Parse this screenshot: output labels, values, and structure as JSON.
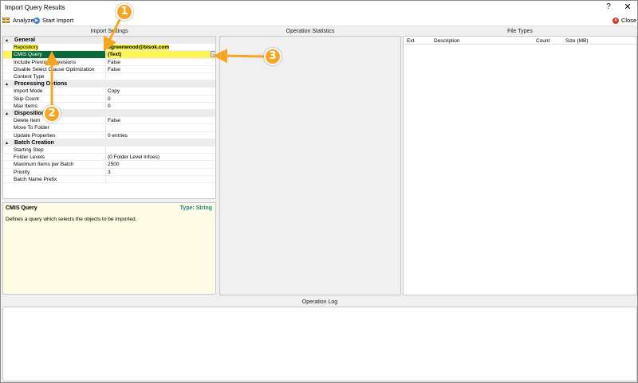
{
  "window": {
    "title": "Import Query Results",
    "help_glyph": "?",
    "close_glyph": "✕"
  },
  "toolbar": {
    "analyze_label": "Analyze",
    "start_import_label": "Start Import",
    "close_label": "Close"
  },
  "panels": {
    "import_settings": "Import Settings",
    "operation_statistics": "Operation Statistics",
    "file_types": "File Types",
    "operation_log": "Operation Log"
  },
  "settings": {
    "rows": [
      {
        "kind": "cat",
        "label": "General"
      },
      {
        "kind": "prop",
        "label": "Repository",
        "value": "dgreenwood@bisok.com"
      },
      {
        "kind": "prop",
        "label": "CMIS Query",
        "value": "(Text)"
      },
      {
        "kind": "prop",
        "label": "Include Previous Revisions",
        "value": "False"
      },
      {
        "kind": "prop",
        "label": "Disable Select Clause Optimization",
        "value": "False"
      },
      {
        "kind": "prop",
        "label": "Content Type",
        "value": ""
      },
      {
        "kind": "cat",
        "label": "Processing Options"
      },
      {
        "kind": "prop",
        "label": "Import Mode",
        "value": "Copy"
      },
      {
        "kind": "prop",
        "label": "Skip Count",
        "value": "0"
      },
      {
        "kind": "prop",
        "label": "Max Items",
        "value": "0"
      },
      {
        "kind": "cat",
        "label": "Disposition"
      },
      {
        "kind": "prop",
        "label": "Delete Item",
        "value": "False"
      },
      {
        "kind": "prop",
        "label": "Move To Folder",
        "value": ""
      },
      {
        "kind": "prop",
        "label": "Update Properties",
        "value": "0 entries"
      },
      {
        "kind": "cat",
        "label": "Batch Creation"
      },
      {
        "kind": "prop",
        "label": "Starting Step",
        "value": ""
      },
      {
        "kind": "prop",
        "label": "Folder Levels",
        "value": "(0 Folder Level Infoes)"
      },
      {
        "kind": "prop",
        "label": "Maximum Items per Batch",
        "value": "2500"
      },
      {
        "kind": "prop",
        "label": "Priority",
        "value": "3"
      },
      {
        "kind": "prop",
        "label": "Batch Name Prefix",
        "value": ""
      }
    ],
    "ellipsis": "..."
  },
  "description": {
    "title": "CMIS Query",
    "type": "Type: String",
    "text": "Defines a query which selects the objects to be imported."
  },
  "file_types": {
    "columns": [
      "Ext",
      "Description",
      "Count",
      "Size (MB)"
    ]
  },
  "callouts": [
    "1",
    "2",
    "3"
  ],
  "colors": {
    "highlight": "#f8f03a",
    "selected": "#0a6a3a",
    "callout": "#f5a623",
    "type_accent": "#1e8a8a"
  }
}
